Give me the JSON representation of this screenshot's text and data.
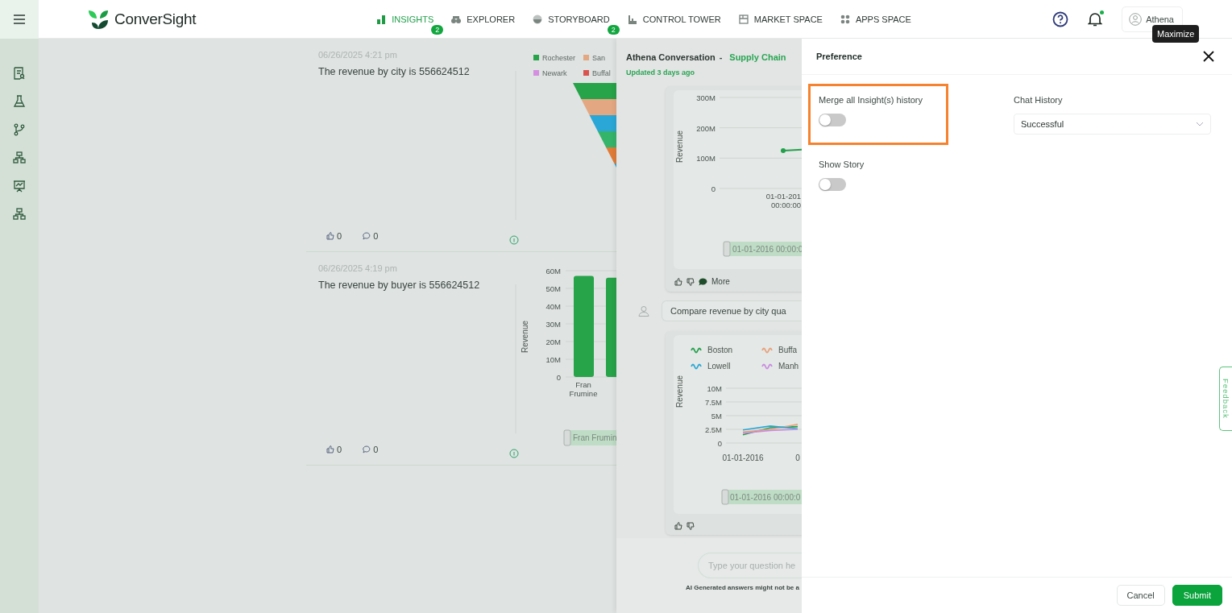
{
  "app": {
    "logo": "ConverSight"
  },
  "nav": [
    {
      "label": "INSIGHTS",
      "selected": true,
      "badge": "2"
    },
    {
      "label": "EXPLORER",
      "selected": false
    },
    {
      "label": "STORYBOARD",
      "selected": false,
      "badge": "2"
    },
    {
      "label": "CONTROL TOWER",
      "selected": false
    },
    {
      "label": "MARKET SPACE",
      "selected": false
    },
    {
      "label": "APPS SPACE",
      "selected": false
    }
  ],
  "notifications": {
    "unread": true
  },
  "user": {
    "name": "Athena"
  },
  "tooltip": "Maximize",
  "insights": [
    {
      "date": "06/26/2025 4:21 pm",
      "text": "The revenue by city is 556624512",
      "likes": "0",
      "comments": "0",
      "chart": {
        "kind": "funnel",
        "legend": [
          {
            "label": "Rochester",
            "color": "#27a349"
          },
          {
            "label": "San",
            "color": "#e3a882"
          },
          {
            "label": "Newark",
            "color": "#d58fe0"
          },
          {
            "label": "Buffal",
            "color": "#d9534f"
          }
        ]
      }
    },
    {
      "date": "06/26/2025 4:19 pm",
      "text": "The revenue by buyer is 556624512",
      "likes": "0",
      "comments": "0",
      "slider_label": "Fran Frumin",
      "chart_data": {
        "type": "bar",
        "ylabel": "Revenue",
        "categories": [
          "Fran Frumine",
          null
        ],
        "values": [
          57000000,
          56000000
        ],
        "ylim": [
          0,
          60000000
        ],
        "grid": true,
        "yticks": [
          {
            "value": 0,
            "label": "0"
          },
          {
            "value": 10000000,
            "label": "10M"
          },
          {
            "value": 20000000,
            "label": "20M"
          },
          {
            "value": 30000000,
            "label": "30M"
          },
          {
            "value": 40000000,
            "label": "40M"
          },
          {
            "value": 50000000,
            "label": "50M"
          },
          {
            "value": 60000000,
            "label": "60M"
          }
        ]
      }
    }
  ],
  "conversation": {
    "title": "Athena Conversation",
    "separator": "-",
    "topic": "Supply Chain",
    "updated": "Updated 3 days ago",
    "messages": [
      {
        "kind": "answer",
        "more": "More",
        "slider_label": "01-01-2016 00:00:0",
        "chart_data": {
          "type": "line",
          "ylabel": "Revenue",
          "categories": [
            "01-01-201 00:00:00"
          ],
          "ylim": [
            0,
            300000000
          ],
          "grid": true,
          "series": [
            {
              "color": "#22a04b",
              "marker": true,
              "values": [
                125000000
              ]
            }
          ],
          "yticks": [
            {
              "value": 0,
              "label": "0"
            },
            {
              "value": 100000000,
              "label": "100M"
            },
            {
              "value": 200000000,
              "label": "200M"
            },
            {
              "value": 300000000,
              "label": "300M"
            }
          ]
        }
      },
      {
        "kind": "question",
        "text": "Compare revenue by city qua"
      },
      {
        "kind": "answer",
        "slider_label": "01-01-2016 00:00:0",
        "chart_data": {
          "type": "line",
          "ylabel": "Revenue",
          "categories": [
            "01-01-2016",
            null,
            "0"
          ],
          "ylim": [
            0,
            10000000
          ],
          "grid": true,
          "legend": true,
          "series": [
            {
              "name": "Boston",
              "color": "#22a04b",
              "values": [
                1500000,
                2800000,
                3000000
              ]
            },
            {
              "name": "Buffa",
              "color": "#e8a07a",
              "values": [
                2000000,
                2500000,
                3400000
              ]
            },
            {
              "name": "Lowell",
              "color": "#2aa7d6",
              "values": [
                2400000,
                3100000,
                2600000
              ]
            },
            {
              "name": "Manh",
              "color": "#c98be0",
              "values": [
                1800000,
                2300000,
                2500000
              ]
            }
          ],
          "yticks": [
            {
              "value": 0,
              "label": "0"
            },
            {
              "value": 2500000,
              "label": "2.5M"
            },
            {
              "value": 5000000,
              "label": "5M"
            },
            {
              "value": 7500000,
              "label": "7.5M"
            },
            {
              "value": 10000000,
              "label": "10M"
            }
          ]
        }
      }
    ],
    "input": {
      "placeholder": "Type your question he"
    },
    "disclaimer": "AI Generated answers might not be a"
  },
  "preference": {
    "title": "Preference",
    "fields": [
      {
        "kind": "toggle",
        "label": "Merge all Insight(s) history",
        "on": false,
        "highlighted": true
      },
      {
        "kind": "select",
        "label": "Chat History",
        "value": "Successful"
      },
      {
        "kind": "toggle",
        "label": "Show Story",
        "on": false,
        "highlighted": false
      }
    ],
    "buttons": [
      {
        "label": "Cancel",
        "kind": "secondary"
      },
      {
        "label": "Submit",
        "kind": "primary"
      }
    ]
  },
  "feedback": "Feedback"
}
